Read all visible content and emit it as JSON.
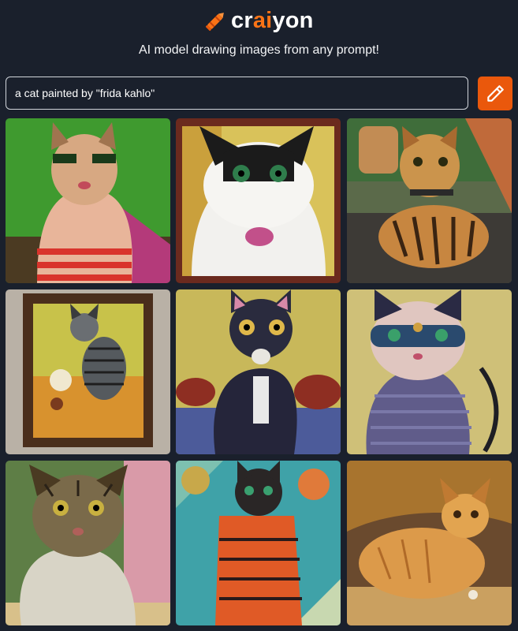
{
  "header": {
    "logo": {
      "text_prefix": "cr",
      "text_accent": "ai",
      "text_suffix": "yon",
      "icon": "crayon-icon",
      "accent_color": "#f97316"
    },
    "tagline": "AI model drawing images from any prompt!"
  },
  "search": {
    "value": "a cat painted by \"frida kahlo\"",
    "placeholder": ""
  },
  "draw_button": {
    "icon": "pencil-icon",
    "color": "#ea580c"
  },
  "results": [
    {
      "name": "result-image-1",
      "alt": "cat on green background with red striped body"
    },
    {
      "name": "result-image-2",
      "alt": "black and white cat portrait in frame"
    },
    {
      "name": "result-image-3",
      "alt": "tabby tiger-striped cat"
    },
    {
      "name": "result-image-4",
      "alt": "framed painting of grey tabby cat"
    },
    {
      "name": "result-image-5",
      "alt": "black cat with flowers"
    },
    {
      "name": "result-image-6",
      "alt": "purple cat with jeweled face"
    },
    {
      "name": "result-image-7",
      "alt": "green-toned tabby cat"
    },
    {
      "name": "result-image-8",
      "alt": "orange striped cat with flowers"
    },
    {
      "name": "result-image-9",
      "alt": "orange cat lying down"
    }
  ],
  "colors": {
    "background": "#1a202c",
    "accent": "#f97316"
  }
}
